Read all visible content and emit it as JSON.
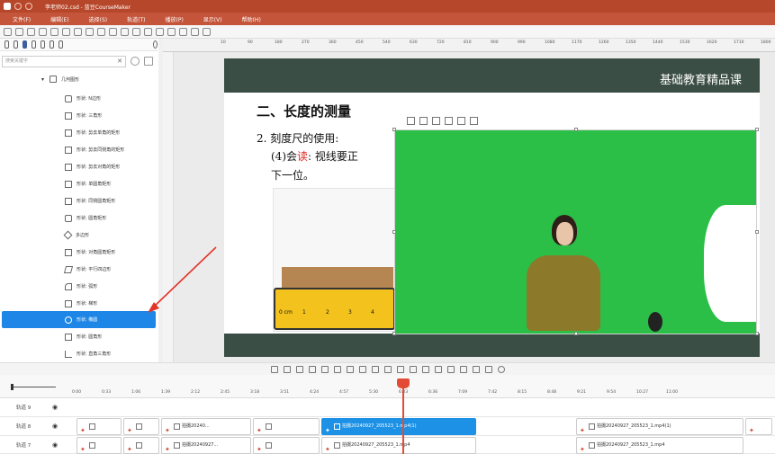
{
  "app": {
    "title": "李老师02.csd - 蓝豆CourseMaker"
  },
  "menu": [
    "文件(F)",
    "编辑(E)",
    "选择(S)",
    "轨道(T)",
    "播放(P)",
    "显示(V)",
    "帮助(H)"
  ],
  "sidebar": {
    "search_placeholder": "搜索关键字",
    "group": "几何图形",
    "items": [
      "形状: N边形",
      "形状: 三角形",
      "形状: 剪去单角的矩形",
      "形状: 剪去同侧角的矩形",
      "形状: 剪去对角的矩形",
      "形状: 单圆角矩形",
      "形状: 同侧圆角矩形",
      "形状: 圆角矩形",
      "多边形",
      "形状: 对角圆角矩形",
      "形状: 平行四边形",
      "形状: 弧形",
      "形状: 梯形",
      "形状: 椭圆",
      "形状: 圆角形",
      "形状: 直角三角形"
    ],
    "selected_index": 13
  },
  "ruler": [
    "10",
    "90",
    "180",
    "270",
    "360",
    "450",
    "540",
    "630",
    "720",
    "810",
    "900",
    "990",
    "1080",
    "1170",
    "1260",
    "1350",
    "1440",
    "1530",
    "1620",
    "1710",
    "1800"
  ],
  "slide": {
    "brand": "基础教育精品课",
    "heading": "二、长度的测量",
    "line1": "2. 刻度尺的使用:",
    "line2_prefix": "(4)会",
    "line2_red": "读",
    "line2_rest": ": 视线要正",
    "line3": "下一位。",
    "ruler_labels": [
      "0 cm",
      "1",
      "2",
      "3",
      "4"
    ]
  },
  "timeline": {
    "ticks": [
      "0:00",
      "0:33",
      "1:06",
      "1:39",
      "2:12",
      "2:45",
      "3:18",
      "3:51",
      "4:24",
      "4:57",
      "5:30",
      "6:03",
      "6:36",
      "7:09",
      "7:42",
      "8:15",
      "8:48",
      "9:21",
      "9:54",
      "10:27",
      "11:00"
    ],
    "tracks": [
      {
        "name": "轨道 9"
      },
      {
        "name": "轨道 8"
      },
      {
        "name": "轨道 7"
      }
    ],
    "clips": {
      "c1": "拍摄20240927_205523_1.mp4(1)",
      "c2": "拍摄20240927_205523_1.mp4(1)",
      "c3": "拍摄20240...",
      "c4": "拍摄20240927...",
      "c5": "拍摄20240927_205523_1.mp4",
      "c6": "拍摄20240927_205523_1.mp4"
    }
  },
  "colors": {
    "accent": "#1e86e6",
    "title_bar": "#b7472a",
    "slide_header": "#3b4e45",
    "green_screen": "#2bbf47",
    "playhead": "#e24c34"
  }
}
